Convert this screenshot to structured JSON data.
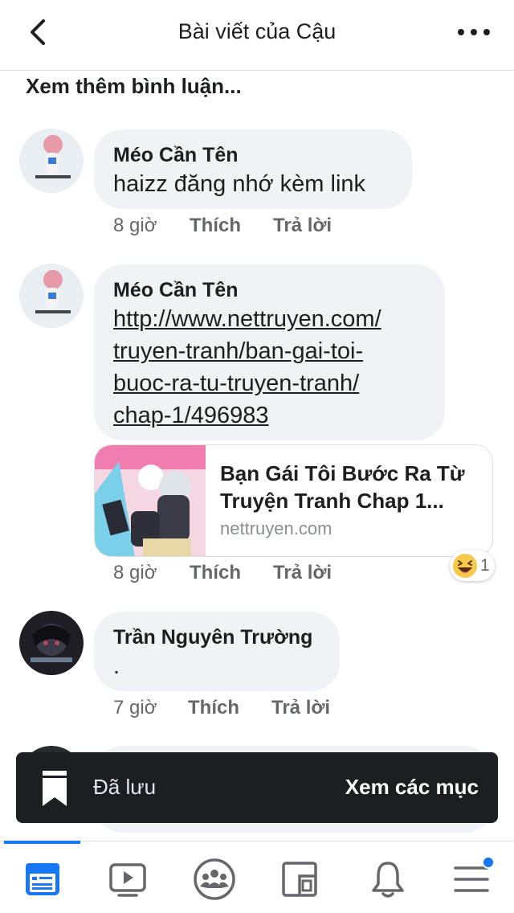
{
  "header": {
    "title": "Bài viết của Cậu",
    "back_icon": "chevron-left-icon",
    "more_icon": "more-horizontal-icon"
  },
  "see_more": "Xem thêm bình luận...",
  "comments": [
    {
      "author": "Méo Cần Tên",
      "text": "haizz đăng nhớ kèm link",
      "time": "8 giờ",
      "like": "Thích",
      "reply": "Trả lời"
    },
    {
      "author": "Méo Cần Tên",
      "link_lines": [
        "http://www.nettruyen.com/",
        "truyen-tranh/ban-gai-toi-",
        "buoc-ra-tu-truyen-tranh/",
        "chap-1/496983"
      ],
      "time": "8 giờ",
      "like": "Thích",
      "reply": "Trả lời",
      "preview": {
        "title": "Bạn Gái Tôi Bước Ra Từ Truyện Tranh Chap 1...",
        "domain": "nettruyen.com"
      },
      "reaction": {
        "icon": "laughing-emoji-icon",
        "count": "1"
      }
    },
    {
      "author": "Trần Nguyên Trường",
      "text": ".",
      "time": "7 giờ",
      "like": "Thích",
      "reply": "Trả lời"
    }
  ],
  "toast": {
    "text": "Đã lưu",
    "action": "Xem các mục",
    "icon": "bookmark-icon"
  },
  "tabbar": {
    "tabs": [
      "news-feed-icon",
      "watch-video-icon",
      "groups-icon",
      "marketplace-icon",
      "notifications-bell-icon",
      "menu-icon"
    ],
    "active_tab": "news-feed-icon",
    "accent": "#1877f2"
  }
}
